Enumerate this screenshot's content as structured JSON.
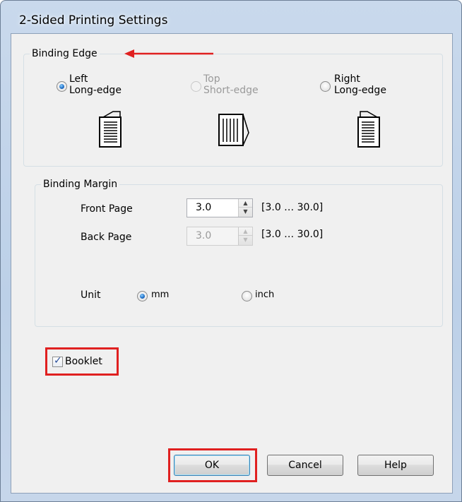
{
  "window": {
    "title": "2-Sided Printing Settings"
  },
  "binding_edge": {
    "legend": "Binding Edge",
    "options": [
      {
        "line1": "Left",
        "line2": "Long-edge",
        "selected": true,
        "enabled": true
      },
      {
        "line1": "Top",
        "line2": "Short-edge",
        "selected": false,
        "enabled": false
      },
      {
        "line1": "Right",
        "line2": "Long-edge",
        "selected": false,
        "enabled": true
      }
    ]
  },
  "binding_margin": {
    "legend": "Binding Margin",
    "front_page": {
      "label": "Front Page",
      "value": "3.0",
      "range": "[3.0 … 30.0]",
      "enabled": true
    },
    "back_page": {
      "label": "Back Page",
      "value": "3.0",
      "range": "[3.0 … 30.0]",
      "enabled": false
    },
    "unit": {
      "label": "Unit",
      "options": [
        {
          "label": "mm",
          "selected": true
        },
        {
          "label": "inch",
          "selected": false
        }
      ]
    }
  },
  "booklet": {
    "label": "Booklet",
    "checked": true
  },
  "buttons": {
    "ok": "OK",
    "cancel": "Cancel",
    "help": "Help"
  },
  "colors": {
    "highlight_red": "#e02020",
    "radio_blue": "#1a6bc4"
  }
}
